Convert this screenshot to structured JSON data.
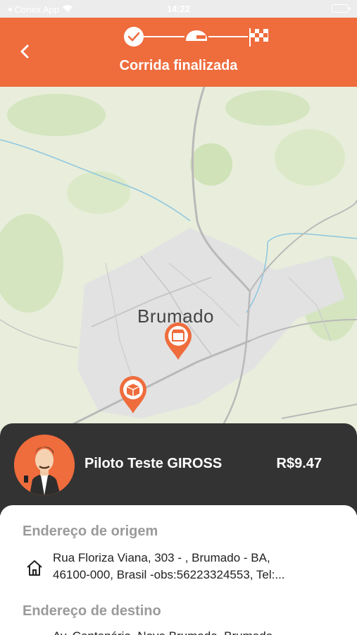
{
  "status_bar": {
    "carrier": "Conex App",
    "time": "14:22"
  },
  "header": {
    "title": "Corrida finalizada",
    "steps": [
      "check-icon",
      "helmet-icon",
      "checkered-flag-icon"
    ],
    "color": "#ef6c3d"
  },
  "map": {
    "city_label": "Brumado"
  },
  "driver": {
    "name": "Piloto Teste GIROSS",
    "price": "R$9.47"
  },
  "origin": {
    "label": "Endereço de origem",
    "line1": "Rua Floriza Viana, 303 - , Brumado - BA,",
    "line2": "46100-000, Brasil -obs:56223324553, Tel:..."
  },
  "destination": {
    "label": "Endereço de destino",
    "line1": "Av. Centenário, Novo Brumado, Brumado"
  }
}
